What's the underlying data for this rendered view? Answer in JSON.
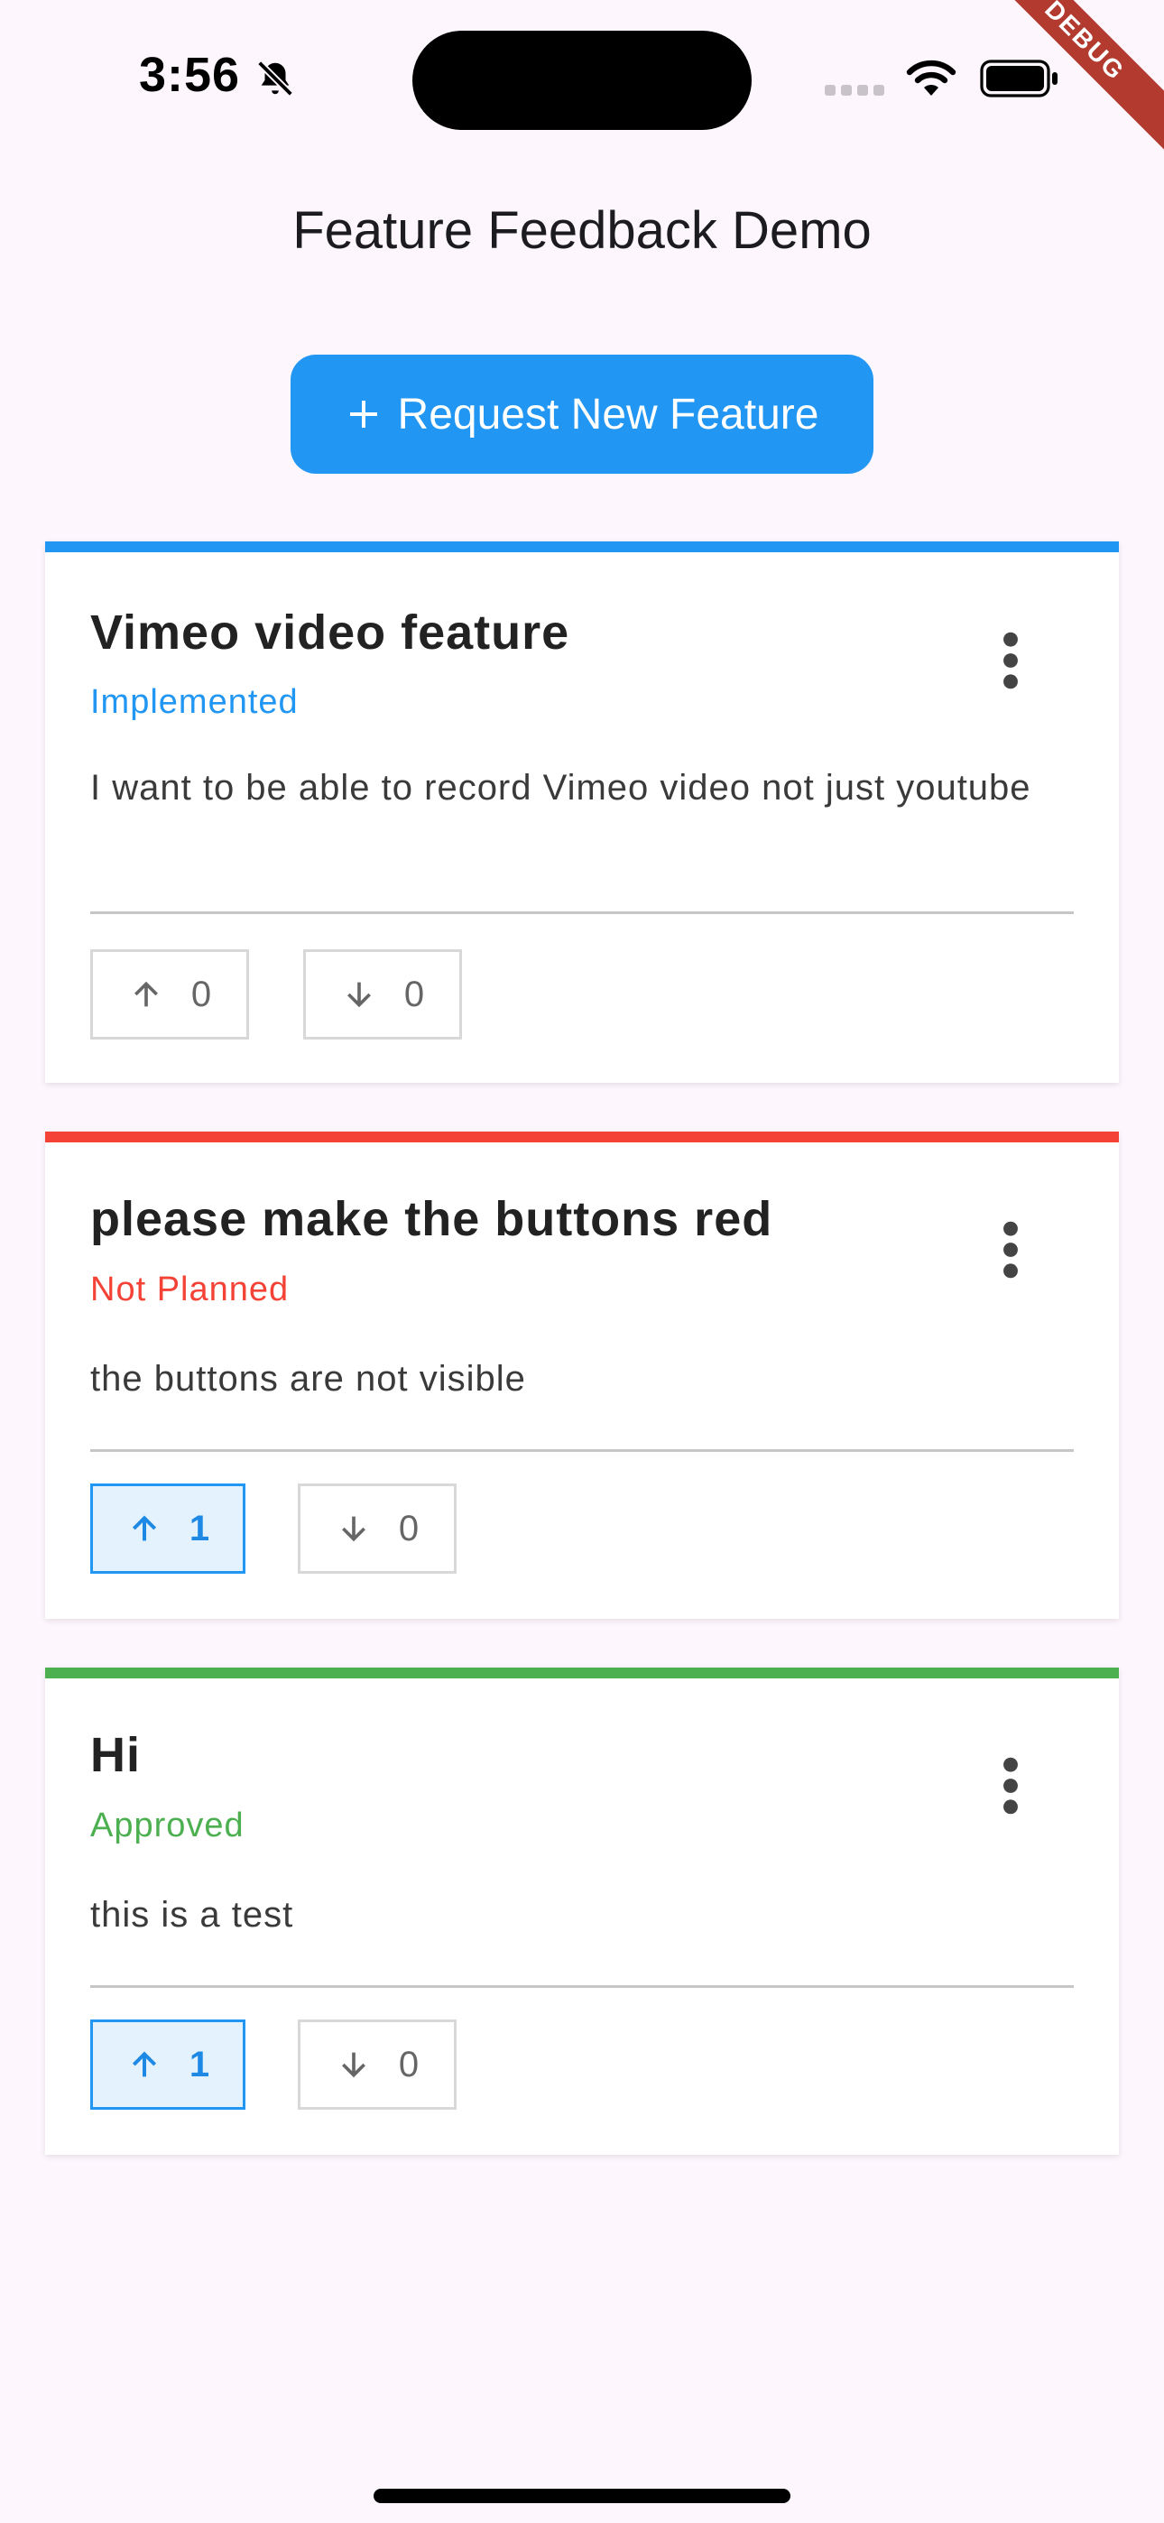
{
  "status_bar": {
    "time": "3:56",
    "debug_label": "DEBUG"
  },
  "app": {
    "title": "Feature Feedback Demo"
  },
  "request_button": {
    "icon": "plus-icon",
    "label": "Request New Feature"
  },
  "colors": {
    "accent": "#2196f3",
    "implemented": "#2196f3",
    "not_planned": "#f44336",
    "approved": "#4caf50",
    "background": "#fdf6fd"
  },
  "features": [
    {
      "title": "Vimeo video feature",
      "status": "Implemented",
      "description": "I want to be able to record Vimeo video not just youtube",
      "upvotes": "0",
      "downvotes": "0",
      "upvoted": false
    },
    {
      "title": "please make the buttons red",
      "status": "Not Planned",
      "description": "the buttons are not visible",
      "upvotes": "1",
      "downvotes": "0",
      "upvoted": true
    },
    {
      "title": "Hi",
      "status": "Approved",
      "description": "this is a test",
      "upvotes": "1",
      "downvotes": "0",
      "upvoted": true
    }
  ]
}
